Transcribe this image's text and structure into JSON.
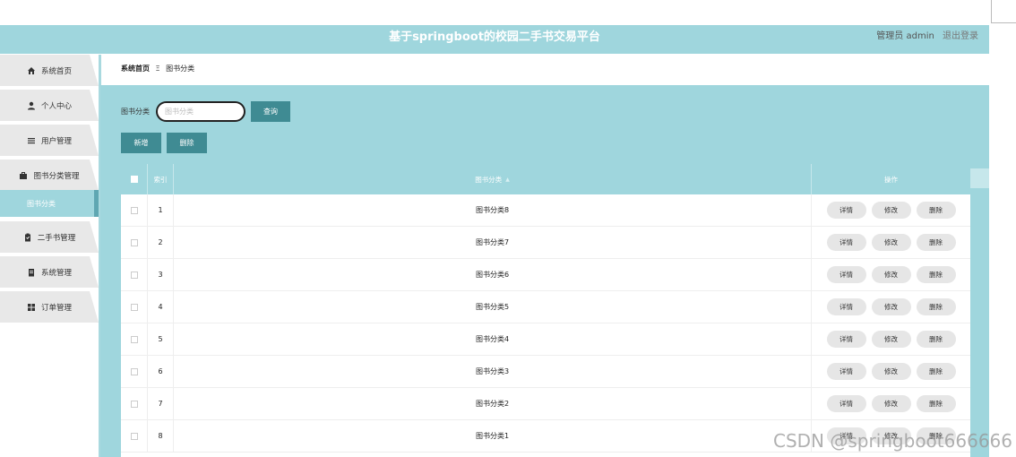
{
  "header": {
    "title": "基于springboot的校园二手书交易平台",
    "user_role": "管理员 admin",
    "logout": "退出登录"
  },
  "sidebar": {
    "items": [
      {
        "label": "系统首页",
        "icon": "home-icon"
      },
      {
        "label": "个人中心",
        "icon": "person-icon"
      },
      {
        "label": "用户管理",
        "icon": "list-icon"
      },
      {
        "label": "图书分类管理",
        "icon": "briefcase-icon"
      },
      {
        "label": "二手书管理",
        "icon": "clipboard-icon"
      },
      {
        "label": "系统管理",
        "icon": "document-icon"
      },
      {
        "label": "订单管理",
        "icon": "grid-icon"
      }
    ],
    "active_sub": "图书分类"
  },
  "breadcrumb": {
    "home": "系统首页",
    "separator": "Ξ",
    "current": "图书分类"
  },
  "search": {
    "label": "图书分类",
    "placeholder": "图书分类",
    "button": "查询"
  },
  "actions": {
    "add": "新增",
    "delete": "删除"
  },
  "table": {
    "headers": {
      "index": "索引",
      "category": "图书分类",
      "ops": "操作"
    },
    "rows": [
      {
        "index": "1",
        "category": "图书分类8"
      },
      {
        "index": "2",
        "category": "图书分类7"
      },
      {
        "index": "3",
        "category": "图书分类6"
      },
      {
        "index": "4",
        "category": "图书分类5"
      },
      {
        "index": "5",
        "category": "图书分类4"
      },
      {
        "index": "6",
        "category": "图书分类3"
      },
      {
        "index": "7",
        "category": "图书分类2"
      },
      {
        "index": "8",
        "category": "图书分类1"
      }
    ],
    "row_actions": {
      "detail": "详情",
      "edit": "修改",
      "delete": "删除"
    }
  },
  "watermark": "CSDN @springboot666666",
  "colors": {
    "accent": "#9fd6dd",
    "button": "#3f8b93",
    "sidebar_item": "#e8e8e8"
  }
}
